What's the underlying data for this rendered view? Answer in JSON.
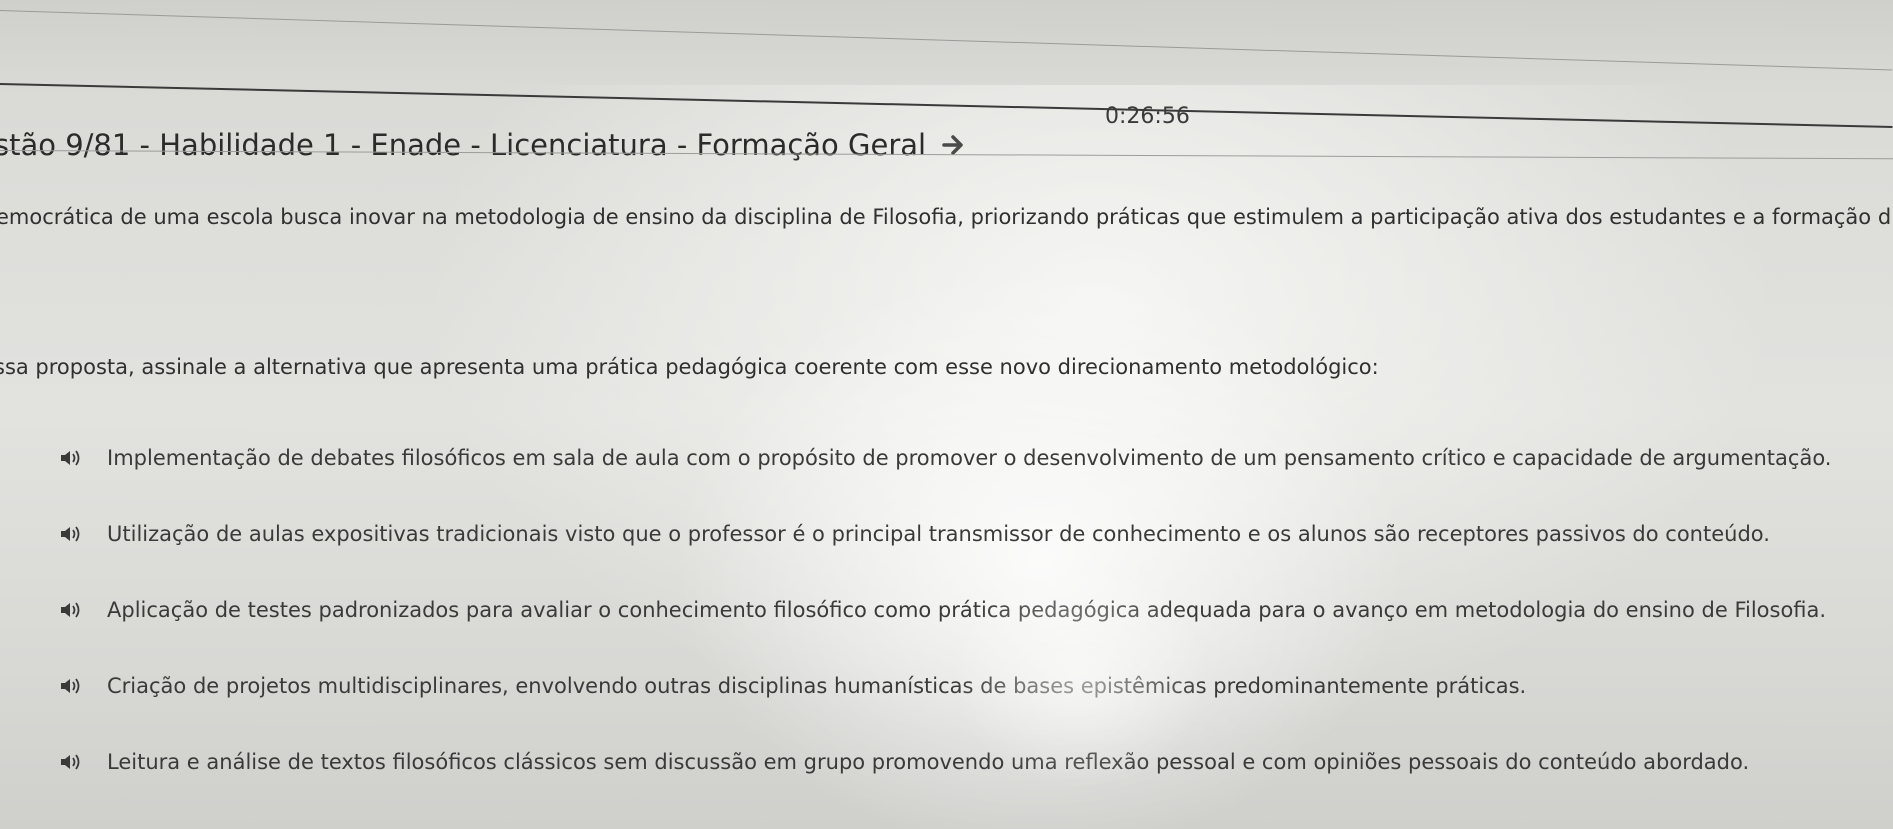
{
  "timer": "0:26:56",
  "question": {
    "title": "stão 9/81 - Habilidade 1 - Enade - Licenciatura - Formação Geral",
    "stem": "emocrática de uma escola busca inovar na metodologia de ensino da disciplina de Filosofia, priorizando práticas que estimulem a participação ativa dos estudantes e a formação d",
    "prompt": "ssa proposta, assinale a alternativa que apresenta uma prática pedagógica coerente com esse novo direcionamento metodológico:"
  },
  "options": [
    {
      "text": "Implementação de debates filosóficos em sala de aula com o propósito de promover o desenvolvimento de um pensamento crítico e capacidade de argumentação."
    },
    {
      "text": "Utilização de aulas expositivas tradicionais visto que o professor é o principal transmissor de conhecimento e os alunos são receptores passivos do conteúdo."
    },
    {
      "text": "Aplicação de testes padronizados para avaliar o conhecimento filosófico como prática pedagógica adequada para o avanço em metodologia do ensino de Filosofia."
    },
    {
      "text": "Criação de projetos multidisciplinares, envolvendo outras disciplinas humanísticas de bases epistêmicas predominantemente práticas."
    },
    {
      "text": "Leitura e análise de textos filosóficos clássicos sem discussão em grupo promovendo uma reflexão pessoal e com opiniões pessoais do conteúdo abordado."
    }
  ],
  "icons": {
    "next": "arrow-right-icon",
    "audio": "speaker-icon"
  },
  "colors": {
    "text": "#2f2f2f",
    "icon": "#3a3a3a"
  }
}
